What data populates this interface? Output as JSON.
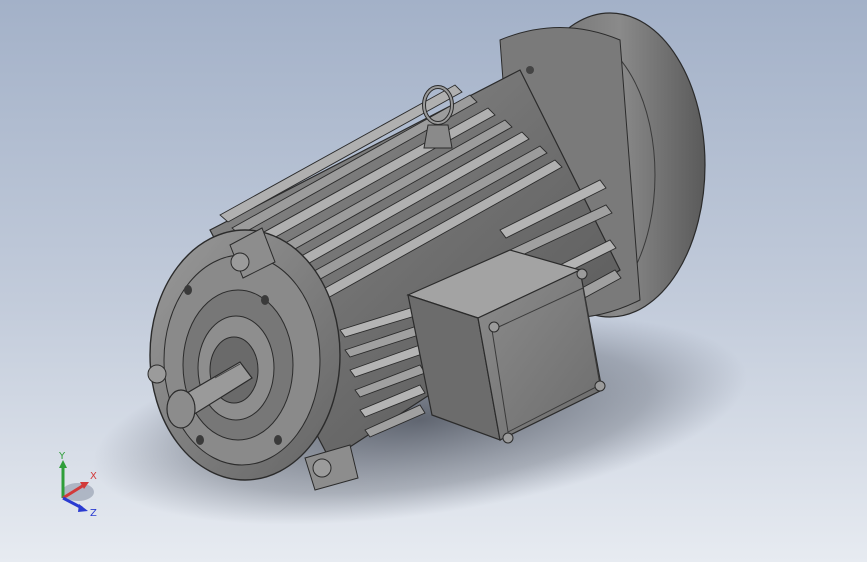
{
  "viewport": {
    "model": "electric-motor-3d-model",
    "background": {
      "top": "#a3b1c8",
      "bottom": "#e7ebf1"
    }
  },
  "triad": {
    "x": {
      "label": "X",
      "color": "#d23a3a"
    },
    "y": {
      "label": "Y",
      "color": "#2f9e3a"
    },
    "z": {
      "label": "Z",
      "color": "#2a3bd1"
    }
  }
}
